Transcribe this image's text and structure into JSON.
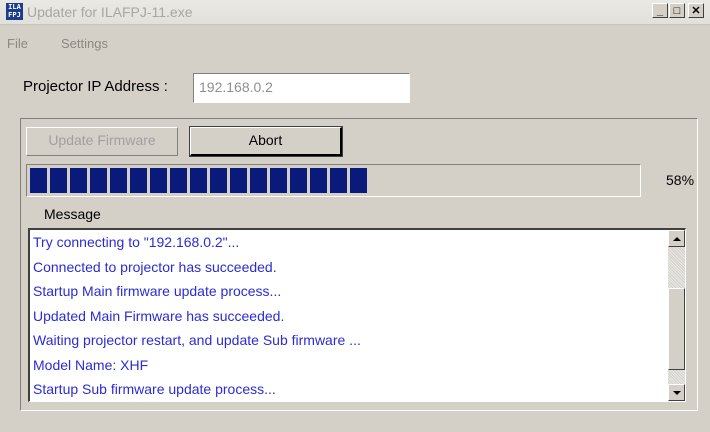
{
  "window": {
    "title": "Updater for ILAFPJ-11.exe",
    "icon_text": "ILA FPJ",
    "icon_name": "app-icon",
    "controls": {
      "minimize": "_",
      "maximize": "□",
      "close": "✕"
    }
  },
  "menu": {
    "file": "File",
    "settings": "Settings"
  },
  "form": {
    "ip_label": "Projector IP Address :",
    "ip_value": "192.168.0.2"
  },
  "actions": {
    "update_firmware": "Update Firmware",
    "abort": "Abort"
  },
  "progress": {
    "percent_text": "58%",
    "fraction": 0.58,
    "fill_color": "#0a1a7a"
  },
  "messages": {
    "label": "Message",
    "lines": [
      "Try connecting to \"192.168.0.2\"...",
      "Connected to projector has succeeded.",
      "Startup Main firmware update process...",
      "Updated Main Firmware has succeeded.",
      "Waiting projector restart, and update Sub firmware ...",
      "Model Name: XHF",
      "Startup Sub firmware update process..."
    ],
    "text_color": "#2b2bd6"
  }
}
